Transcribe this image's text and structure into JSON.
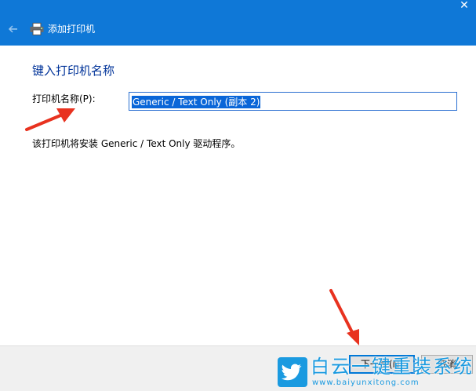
{
  "window": {
    "title": "添加打印机",
    "close_glyph": "✕"
  },
  "content": {
    "heading": "键入打印机名称",
    "name_label": "打印机名称(P):",
    "name_value": "Generic / Text Only (副本 2)",
    "info": "该打印机将安装 Generic / Text Only 驱动程序。"
  },
  "footer": {
    "next_label": "下一步(N)",
    "cancel_label": "取消"
  },
  "watermark": {
    "title": "白云一键重装系统",
    "url": "www.baiyunxitong.com"
  },
  "colors": {
    "titlebar": "#0f78d7",
    "heading": "#003399",
    "annotation_arrow": "#e8321f",
    "watermark": "#1a9ae0"
  },
  "icons": [
    "back-arrow-icon",
    "printer-icon",
    "close-icon",
    "twitter-bird-icon"
  ]
}
